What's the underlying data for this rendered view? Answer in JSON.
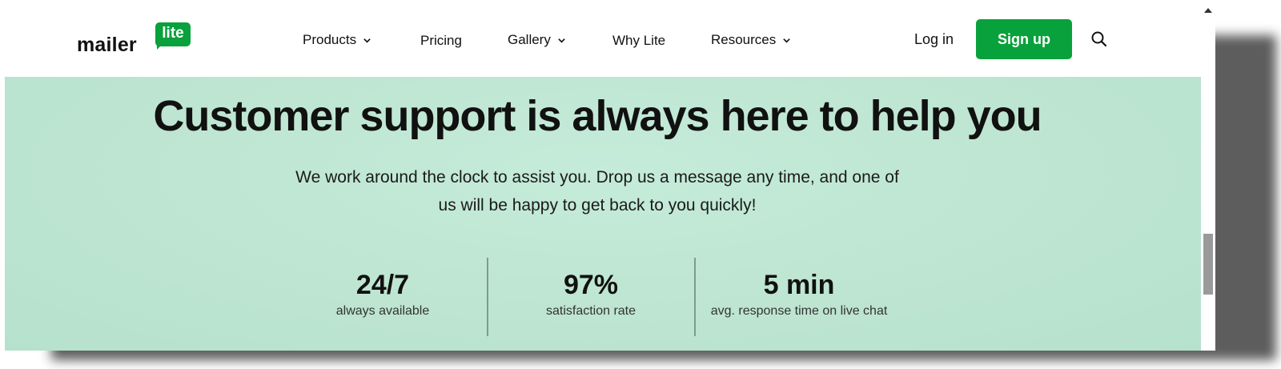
{
  "header": {
    "logo": {
      "word": "mailer",
      "badge": "lite"
    },
    "nav": [
      {
        "label": "Products",
        "dropdown": true
      },
      {
        "label": "Pricing",
        "dropdown": false
      },
      {
        "label": "Gallery",
        "dropdown": true
      },
      {
        "label": "Why Lite",
        "dropdown": false
      },
      {
        "label": "Resources",
        "dropdown": true
      }
    ],
    "login_label": "Log in",
    "signup_label": "Sign up",
    "search_icon": "search-icon"
  },
  "hero": {
    "title": "Customer support is always here to help you",
    "subtitle_line1": "We work around the clock to assist you. Drop us a message any time, and one of",
    "subtitle_line2": "us will be happy to get back to you quickly!",
    "stats": [
      {
        "value": "24/7",
        "label": "always available"
      },
      {
        "value": "97%",
        "label": "satisfaction rate"
      },
      {
        "value": "5 min",
        "label": "avg. response time on live chat"
      }
    ]
  },
  "colors": {
    "brand_green": "#09a13b",
    "hero_background": "#bfe6d3",
    "text": "#111111"
  }
}
